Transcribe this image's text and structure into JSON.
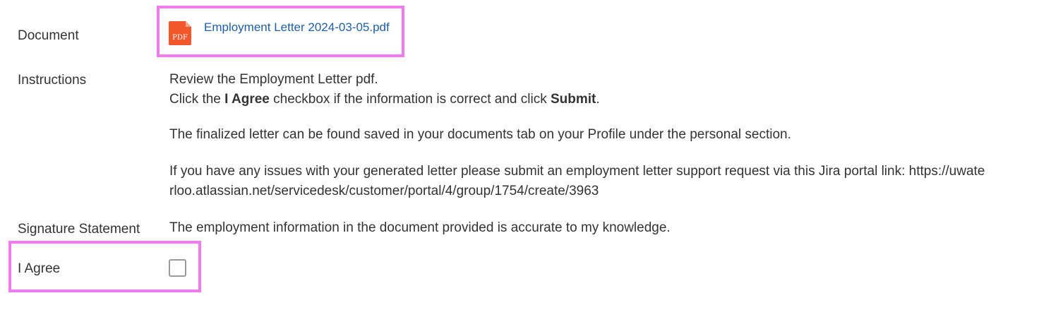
{
  "document": {
    "label": "Document",
    "file_name": "Employment Letter 2024-03-05.pdf",
    "file_icon": "pdf-icon",
    "file_icon_text": "PDF",
    "file_icon_color": "#f2572b"
  },
  "instructions": {
    "label": "Instructions",
    "line1": "Review the Employment Letter pdf.",
    "line2_prefix": "Click the ",
    "line2_bold1": "I Agree",
    "line2_middle": " checkbox if the information is correct and click ",
    "line2_bold2": "Submit",
    "line2_suffix": ".",
    "paragraph2": "The finalized letter can be found saved in your documents tab on your Profile under the personal section.",
    "paragraph3_line1": "If you have any issues with your generated letter please submit an employment letter support request via this Jira portal link: https://uwate",
    "paragraph3_line2": "rloo.atlassian.net/servicedesk/customer/portal/4/group/1754/create/3963"
  },
  "signature_statement": {
    "label": "Signature Statement",
    "text": "The employment information in the document provided is accurate to my knowledge."
  },
  "agree": {
    "label": "I Agree",
    "checked": false
  },
  "colors": {
    "highlight": "#f07cf0",
    "link": "#1f5fa8",
    "text": "#333333"
  }
}
